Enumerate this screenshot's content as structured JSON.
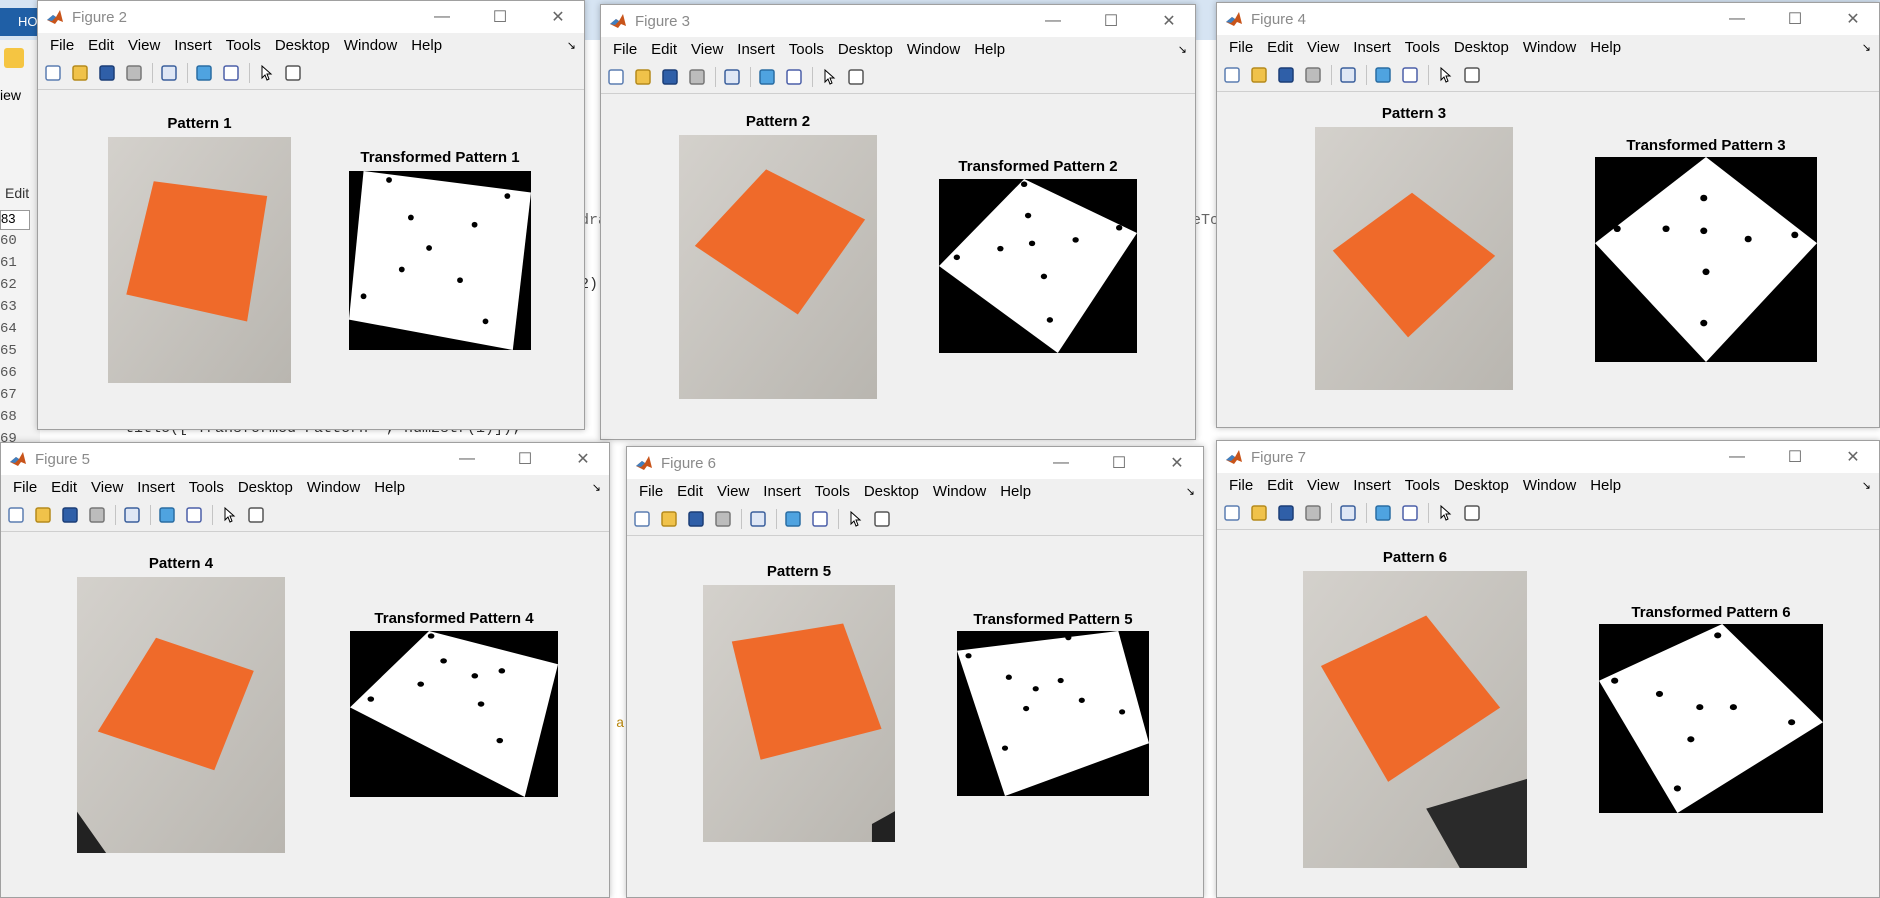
{
  "background": {
    "home_tab": "HO",
    "line_numbers": [
      "60",
      "61",
      "62",
      "63",
      "64",
      "65",
      "66",
      "67",
      "68",
      "69"
    ],
    "tab_83": "83",
    "edit_label": "Edit",
    "code_snip_1": "2)",
    "code_title": "title(['Transformed Pattern ', num2str(i)]);",
    "code_frag_a": "a",
    "code_frag_b": "dra",
    "code_frag_c": "eTo",
    "code_frag_view": "iew"
  },
  "menu_items": [
    "File",
    "Edit",
    "View",
    "Insert",
    "Tools",
    "Desktop",
    "Window",
    "Help"
  ],
  "colors": {
    "orange": "#ef6a2a",
    "paper_bg": "#cfcbc4",
    "black": "#000000",
    "white": "#ffffff"
  },
  "figures": [
    {
      "title": "Figure 2",
      "pattern_title": "Pattern 1",
      "transformed_title": "Transformed Pattern 1"
    },
    {
      "title": "Figure 3",
      "pattern_title": "Pattern 2",
      "transformed_title": "Transformed Pattern 2"
    },
    {
      "title": "Figure 4",
      "pattern_title": "Pattern 3",
      "transformed_title": "Transformed Pattern 3"
    },
    {
      "title": "Figure 5",
      "pattern_title": "Pattern 4",
      "transformed_title": "Transformed Pattern 4"
    },
    {
      "title": "Figure 6",
      "pattern_title": "Pattern 5",
      "transformed_title": "Transformed Pattern 5"
    },
    {
      "title": "Figure 7",
      "pattern_title": "Pattern 6",
      "transformed_title": "Transformed Pattern 6"
    }
  ]
}
